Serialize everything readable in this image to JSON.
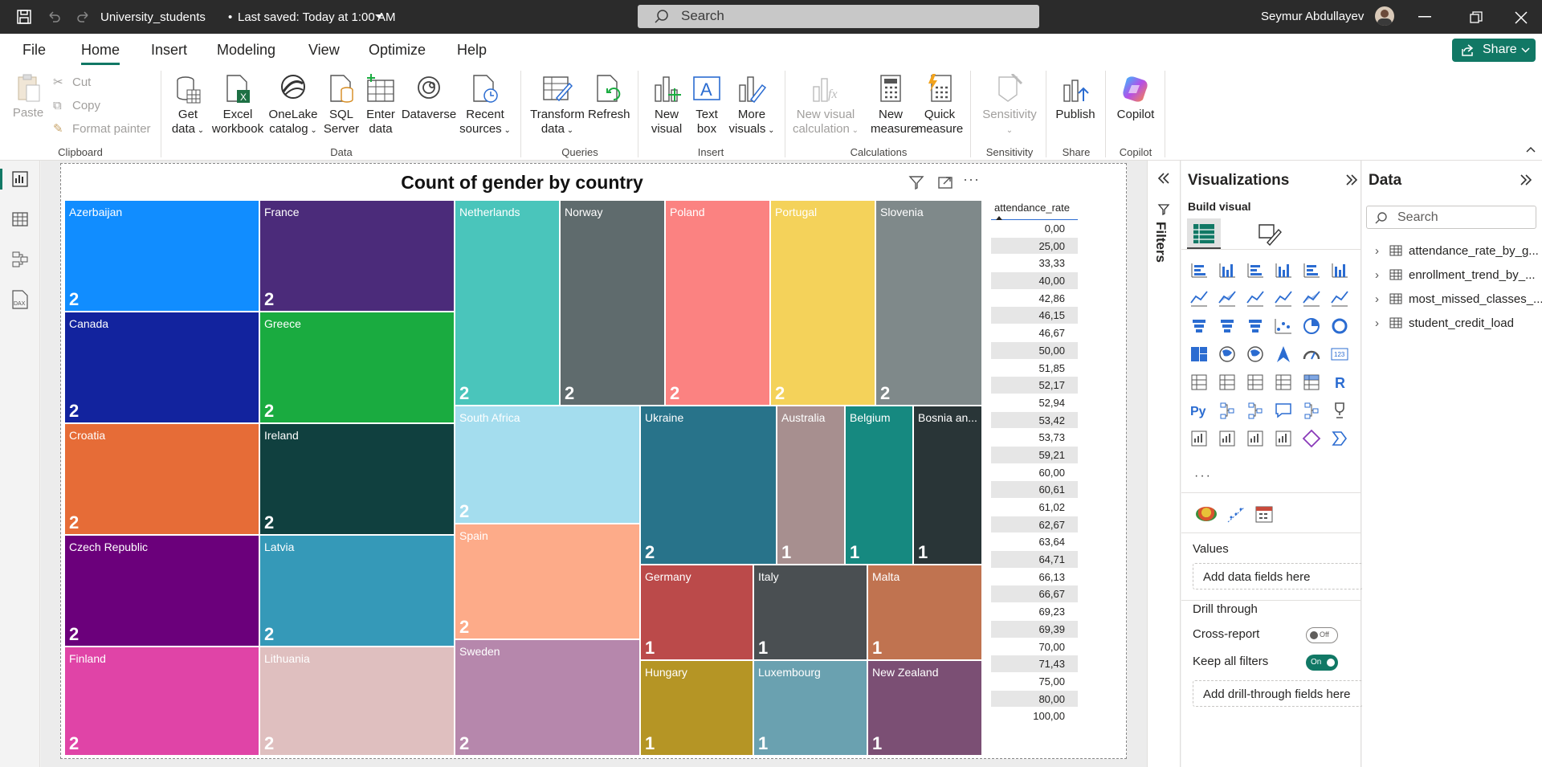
{
  "titlebar": {
    "file_name": "University_students",
    "saved": "Last saved: Today at 1:00 AM",
    "search_placeholder": "Search",
    "user": "Seymur Abdullayev"
  },
  "menu": {
    "items": [
      "File",
      "Home",
      "Insert",
      "Modeling",
      "View",
      "Optimize",
      "Help"
    ],
    "active": "Home",
    "share": "Share"
  },
  "ribbon": {
    "clipboard": {
      "paste": "Paste",
      "cut": "Cut",
      "copy": "Copy",
      "format_painter": "Format painter",
      "group": "Clipboard"
    },
    "data": {
      "get_data": [
        "Get",
        "data"
      ],
      "excel": [
        "Excel",
        "workbook"
      ],
      "onelake": [
        "OneLake",
        "catalog"
      ],
      "sql": [
        "SQL",
        "Server"
      ],
      "enter": [
        "Enter",
        "data"
      ],
      "dataverse": "Dataverse",
      "recent": [
        "Recent",
        "sources"
      ],
      "group": "Data"
    },
    "queries": {
      "transform": [
        "Transform",
        "data"
      ],
      "refresh": "Refresh",
      "group": "Queries"
    },
    "insert": {
      "new_visual": [
        "New",
        "visual"
      ],
      "text_box": [
        "Text",
        "box"
      ],
      "more": [
        "More",
        "visuals"
      ],
      "group": "Insert"
    },
    "calculations": {
      "new_visual_calc": [
        "New visual",
        "calculation"
      ],
      "new_measure": [
        "New",
        "measure"
      ],
      "quick_measure": [
        "Quick",
        "measure"
      ],
      "group": "Calculations"
    },
    "sensitivity": {
      "label": "Sensitivity",
      "group": "Sensitivity"
    },
    "share": {
      "publish": "Publish",
      "group": "Share"
    },
    "copilot": {
      "label": "Copilot",
      "group": "Copilot"
    }
  },
  "visual": {
    "title": "Count of gender by country",
    "tiles": [
      {
        "country": "Azerbaijan",
        "count": 2,
        "color": "#118dff"
      },
      {
        "country": "France",
        "count": 2,
        "color": "#4b2b7a"
      },
      {
        "country": "Canada",
        "count": 2,
        "color": "#12239e"
      },
      {
        "country": "Greece",
        "count": 2,
        "color": "#1aab40"
      },
      {
        "country": "Croatia",
        "count": 2,
        "color": "#e66c37"
      },
      {
        "country": "Ireland",
        "count": 2,
        "color": "#10403f"
      },
      {
        "country": "Czech Republic",
        "count": 2,
        "color": "#6b007b"
      },
      {
        "country": "Latvia",
        "count": 2,
        "color": "#3599b8"
      },
      {
        "country": "Finland",
        "count": 2,
        "color": "#e044a7"
      },
      {
        "country": "Lithuania",
        "count": 2,
        "color": "#dfbfbf"
      },
      {
        "country": "Netherlands",
        "count": 2,
        "color": "#4ac5bb"
      },
      {
        "country": "Norway",
        "count": 2,
        "color": "#5f6b6d"
      },
      {
        "country": "Poland",
        "count": 2,
        "color": "#fb8281"
      },
      {
        "country": "Portugal",
        "count": 2,
        "color": "#f4d25a"
      },
      {
        "country": "Slovenia",
        "count": 2,
        "color": "#7f898a"
      },
      {
        "country": "South Africa",
        "count": 2,
        "color": "#a4ddee"
      },
      {
        "country": "Spain",
        "count": 2,
        "color": "#fdab89"
      },
      {
        "country": "Sweden",
        "count": 2,
        "color": "#b687ac"
      },
      {
        "country": "Ukraine",
        "count": 2,
        "color": "#28738a"
      },
      {
        "country": "Australia",
        "count": 1,
        "color": "#a78f8f"
      },
      {
        "country": "Belgium",
        "count": 1,
        "color": "#168980"
      },
      {
        "country": "Bosnia an...",
        "count": 1,
        "color": "#293537"
      },
      {
        "country": "Germany",
        "count": 1,
        "color": "#bb4a4a"
      },
      {
        "country": "Italy",
        "count": 1,
        "color": "#4a4f52"
      },
      {
        "country": "Malta",
        "count": 1,
        "color": "#c07350"
      },
      {
        "country": "Hungary",
        "count": 1,
        "color": "#b59525"
      },
      {
        "country": "Luxembourg",
        "count": 1,
        "color": "#6aa1b0"
      },
      {
        "country": "New Zealand",
        "count": 1,
        "color": "#7b4f74"
      }
    ]
  },
  "slicer": {
    "field": "attendance_rate",
    "values": [
      "0,00",
      "25,00",
      "33,33",
      "40,00",
      "42,86",
      "46,15",
      "46,67",
      "50,00",
      "51,85",
      "52,17",
      "52,94",
      "53,42",
      "53,73",
      "59,21",
      "60,00",
      "60,61",
      "61,02",
      "62,67",
      "63,64",
      "64,71",
      "66,13",
      "66,67",
      "69,23",
      "69,39",
      "70,00",
      "71,43",
      "75,00",
      "80,00",
      "100,00"
    ]
  },
  "filters": {
    "label": "Filters"
  },
  "visualizations": {
    "title": "Visualizations",
    "build_visual": "Build visual",
    "values_label": "Values",
    "add_data": "Add data fields here",
    "drill_through": "Drill through",
    "cross_report": "Cross-report",
    "cross_report_state": "Off",
    "keep_filters": "Keep all filters",
    "keep_filters_state": "On",
    "add_drill": "Add drill-through fields here",
    "more": "···"
  },
  "data_pane": {
    "title": "Data",
    "search_placeholder": "Search",
    "tables": [
      "attendance_rate_by_g...",
      "enrollment_trend_by_...",
      "most_missed_classes_...",
      "student_credit_load"
    ]
  }
}
